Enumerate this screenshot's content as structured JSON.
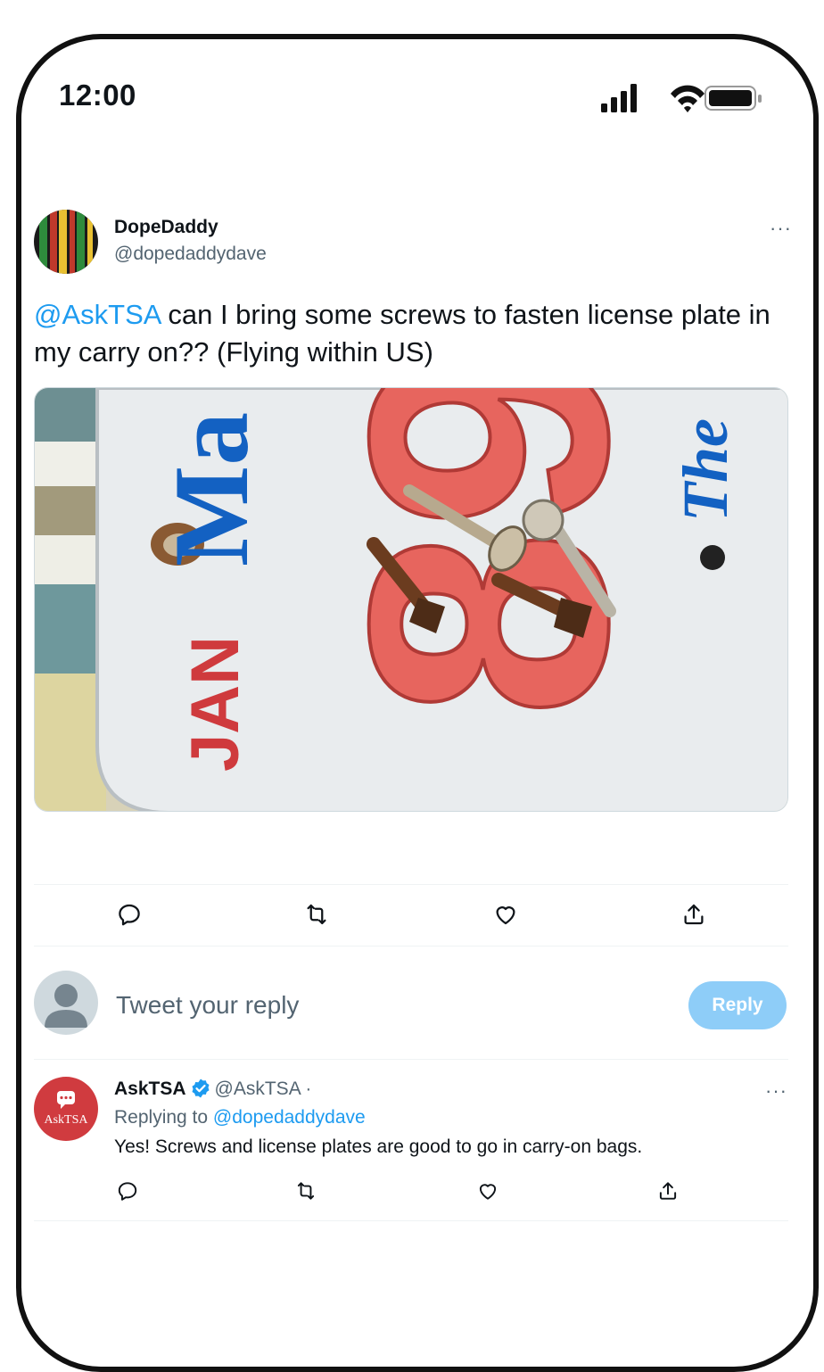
{
  "status_bar": {
    "time": "12:00",
    "icons": [
      "cellular-signal-icon",
      "wifi-icon",
      "battery-icon"
    ]
  },
  "tweet": {
    "author_name": "DopeDaddy",
    "author_handle": "@dopedaddydave",
    "more_label": "···",
    "text_mention": "@AskTSA",
    "text_body": " can I bring some screws to fasten license plate in my carry on?? (Flying within US)",
    "media": {
      "plate_text_month": "JAN",
      "plate_text_state": "Ma",
      "plate_text_motto": "The",
      "plate_number": "89"
    },
    "actions": [
      "reply-icon",
      "retweet-icon",
      "like-icon",
      "share-icon"
    ]
  },
  "compose": {
    "placeholder": "Tweet your reply",
    "reply_button_label": "Reply"
  },
  "reply": {
    "avatar_label": "AskTSA",
    "author_name": "AskTSA",
    "author_handle": "@AskTSA ·",
    "replying_to_label": "Replying to ",
    "replying_to_handle": "@dopedaddydave",
    "text": "Yes! Screws and license plates are good to go in carry-on bags.",
    "more_label": "···",
    "actions": [
      "reply-icon",
      "retweet-icon",
      "like-icon",
      "share-icon"
    ]
  },
  "colors": {
    "accent": "#1d9bf0",
    "reply_button_disabled": "#8ecdf8",
    "secondary_text": "#536471",
    "tsa_brand_red": "#d03b3f"
  }
}
